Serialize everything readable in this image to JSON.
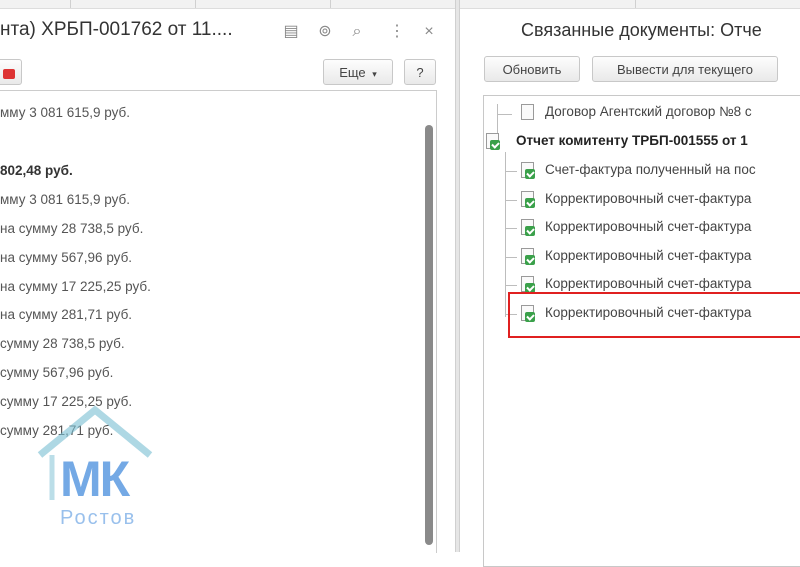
{
  "left_window": {
    "title": "нта) ХРБП-001762 от 11....",
    "more_button": "Еще",
    "help_button": "?",
    "lines": [
      {
        "text": "мму 3 081 615,9 руб.",
        "bold": false
      },
      {
        "text": "802,48 руб.",
        "bold": true
      },
      {
        "text": "мму 3 081 615,9 руб.",
        "bold": false
      },
      {
        "text": "на сумму 28 738,5 руб.",
        "bold": false
      },
      {
        "text": "на сумму 567,96 руб.",
        "bold": false
      },
      {
        "text": "на сумму 17 225,25 руб.",
        "bold": false
      },
      {
        "text": "на сумму 281,71 руб.",
        "bold": false
      },
      {
        "text": "сумму 28 738,5 руб.",
        "bold": false
      },
      {
        "text": "сумму 567,96 руб.",
        "bold": false
      },
      {
        "text": "сумму 17 225,25 руб.",
        "bold": false
      },
      {
        "text": "сумму 281,71 руб.",
        "bold": false
      }
    ]
  },
  "right_window": {
    "title": "Связанные документы: Отче",
    "refresh_button": "Обновить",
    "show_for_current_button": "Вывести для текущего",
    "tree": [
      {
        "text": "Договор Агентский договор №8 с",
        "bold": false,
        "check": false
      },
      {
        "text": "Отчет комитенту ТРБП-001555 от 1",
        "bold": true,
        "check": true
      },
      {
        "text": "Счет-фактура полученный на пос",
        "bold": false,
        "check": true
      },
      {
        "text": "Корректировочный счет-фактура",
        "bold": false,
        "check": true
      },
      {
        "text": "Корректировочный счет-фактура",
        "bold": false,
        "check": true
      },
      {
        "text": "Корректировочный счет-фактура",
        "bold": false,
        "check": true
      },
      {
        "text": "Корректировочный счет-фактура",
        "bold": false,
        "check": true
      },
      {
        "text": "Корректировочный счет-фактура",
        "bold": false,
        "check": true
      }
    ]
  },
  "watermark": {
    "letters": "МК",
    "city": "Ростов"
  },
  "colors": {
    "highlight": "#e02020",
    "check": "#3aa04a",
    "watermark": "#468cdc"
  }
}
